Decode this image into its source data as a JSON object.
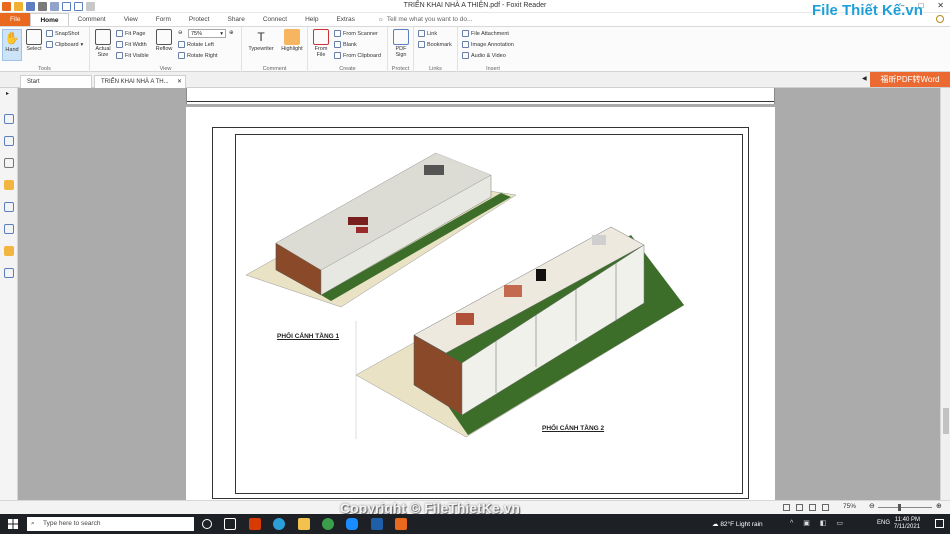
{
  "window": {
    "title": "TRIỂN KHAI NHÀ A THIỆN.pdf - Foxit Reader"
  },
  "menu_tabs": [
    {
      "label": "File"
    },
    {
      "label": "Home"
    },
    {
      "label": "Comment"
    },
    {
      "label": "View"
    },
    {
      "label": "Form"
    },
    {
      "label": "Protect"
    },
    {
      "label": "Share"
    },
    {
      "label": "Connect"
    },
    {
      "label": "Help"
    },
    {
      "label": "Extras"
    }
  ],
  "tell_me": {
    "placeholder": "Tell me what you want to do..."
  },
  "ribbon": {
    "tools": {
      "label": "Tools",
      "hand": "Hand",
      "select": "Select",
      "snapshot": "SnapShot",
      "clipboard": "Clipboard"
    },
    "view": {
      "label": "View",
      "actual_size": "Actual Size",
      "fit_page": "Fit Page",
      "fit_width": "Fit Width",
      "fit_visible": "Fit Visible",
      "reflow": "Reflow",
      "zoom": "75%",
      "rotate_left": "Rotate Left",
      "rotate_right": "Rotate Right"
    },
    "comment": {
      "label": "Comment",
      "typewriter": "Typewriter",
      "highlight": "Highlight"
    },
    "create": {
      "label": "Create",
      "from_file": "From File",
      "from_scanner": "From Scanner",
      "blank": "Blank",
      "from_clipboard": "From Clipboard"
    },
    "protect": {
      "label": "Protect",
      "pdf_sign": "PDF Sign"
    },
    "links": {
      "label": "Links",
      "link": "Link",
      "bookmark": "Bookmark"
    },
    "insert": {
      "label": "Insert",
      "file_attachment": "File Attachment",
      "image_annotation": "Image Annotation",
      "audio_video": "Audio & Video"
    }
  },
  "doc_tabs": {
    "start": "Start",
    "current": "TRIỂN KHAI NHÀ A TH..."
  },
  "convert_button": "福昕PDF转Word",
  "brand_logo": "File Thiết Kế.vn",
  "drawing": {
    "label_floor1": "PHỐI CẢNH TẦNG 1",
    "label_floor2": "PHỐI CẢNH TẦNG 2"
  },
  "status": {
    "zoom": "75%",
    "watermark": "Copyright © FileThietKe.vn"
  },
  "taskbar": {
    "search_placeholder": "Type here to search",
    "weather": "82°F  Light rain",
    "lang": "ENG",
    "time": "11:40 PM",
    "date": "7/11/2021"
  },
  "colors": {
    "accent": "#e96a1e",
    "convert": "#ea6a32",
    "grass": "#3c6e2a",
    "taskbar": "#1d2025"
  }
}
